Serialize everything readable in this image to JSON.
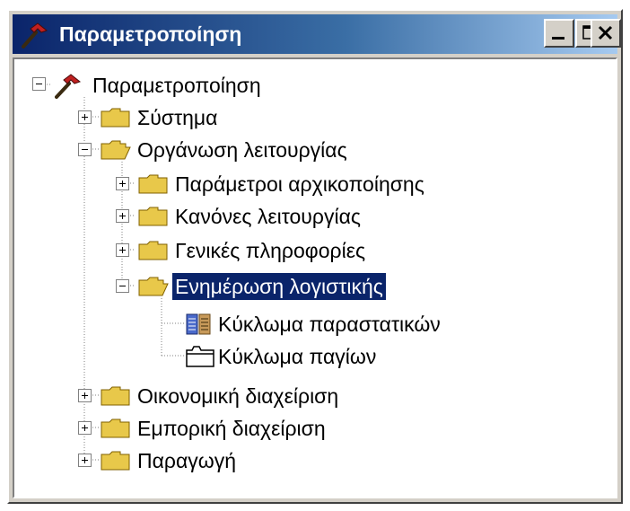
{
  "window": {
    "title": "Παραμετροποίηση",
    "buttons": {
      "minimize": "minimize",
      "maximize": "maximize",
      "close": "close"
    }
  },
  "tree": {
    "root": "Παραμετροποίηση",
    "items": [
      {
        "label": "Σύστημα",
        "state": "collapsed"
      },
      {
        "label": "Οργάνωση λειτουργίας",
        "state": "expanded",
        "children": [
          {
            "label": "Παράμετροι αρχικοποίησης",
            "state": "collapsed"
          },
          {
            "label": "Κανόνες λειτουργίας",
            "state": "collapsed"
          },
          {
            "label": "Γενικές πληροφορίες",
            "state": "collapsed"
          },
          {
            "label": "Ενημέρωση λογιστικής",
            "state": "expanded",
            "selected": true,
            "children": [
              {
                "label": "Κύκλωμα παραστατικών",
                "icon": "documents-icon"
              },
              {
                "label": "Κύκλωμα παγίων",
                "icon": "folder-tab-icon"
              }
            ]
          }
        ]
      },
      {
        "label": "Οικονομική διαχείριση",
        "state": "collapsed"
      },
      {
        "label": "Εμπορική διαχείριση",
        "state": "collapsed"
      },
      {
        "label": "Παραγωγή",
        "state": "collapsed"
      }
    ]
  },
  "colors": {
    "titlebar": "#0a246a",
    "selection": "#0a246a",
    "folder": "#e8c84a"
  }
}
